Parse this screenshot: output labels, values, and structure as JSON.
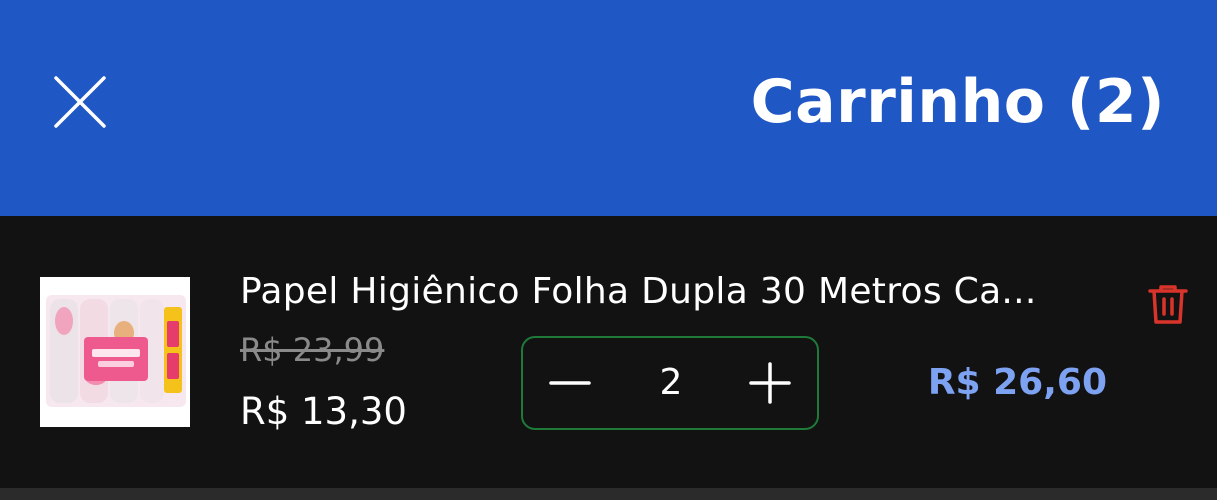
{
  "header": {
    "title": "Carrinho (2)",
    "close_icon": "close-icon",
    "background": "#1f57c4"
  },
  "cart": {
    "items": [
      {
        "name": "Papel Higiênico Folha Dupla 30 Metros Ca...",
        "old_price": "R$ 23,99",
        "price": "R$ 13,30",
        "quantity": "2",
        "total": "R$ 26,60",
        "image": "toilet-paper-pack-thumbnail",
        "actions": {
          "decrement_icon": "minus-icon",
          "increment_icon": "plus-icon",
          "remove_icon": "trash-icon"
        }
      }
    ]
  },
  "colors": {
    "total_price": "#7ea2f2",
    "stepper_border": "#1f7a3a",
    "remove_icon": "#d9342b",
    "old_price": "#8a8a8a"
  }
}
